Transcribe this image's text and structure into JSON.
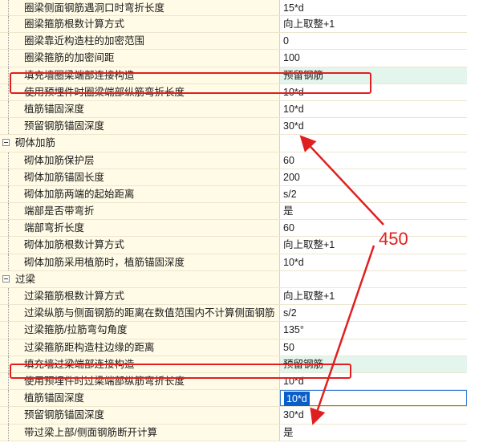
{
  "rows": [
    {
      "label": "圈梁侧面钢筋遇洞口时弯折长度",
      "value": "15*d"
    },
    {
      "label": "圈梁箍筋根数计算方式",
      "value": "向上取整+1"
    },
    {
      "label": "圈梁靠近构造柱的加密范围",
      "value": "0"
    },
    {
      "label": "圈梁箍筋的加密间距",
      "value": "100"
    },
    {
      "label": "填充墙圈梁端部连接构造",
      "value": "预留钢筋",
      "highlight": true
    },
    {
      "label": "使用预埋件时圈梁端部纵筋弯折长度",
      "value": "10*d"
    },
    {
      "label": "植筋锚固深度",
      "value": "10*d"
    },
    {
      "label": "预留钢筋锚固深度",
      "value": "30*d"
    },
    {
      "label": "砌体加筋",
      "value": "",
      "group": true
    },
    {
      "label": "砌体加筋保护层",
      "value": "60"
    },
    {
      "label": "砌体加筋锚固长度",
      "value": "200"
    },
    {
      "label": "砌体加筋两端的起始距离",
      "value": "s/2"
    },
    {
      "label": "端部是否带弯折",
      "value": "是"
    },
    {
      "label": "端部弯折长度",
      "value": "60"
    },
    {
      "label": "砌体加筋根数计算方式",
      "value": "向上取整+1"
    },
    {
      "label": "砌体加筋采用植筋时，植筋锚固深度",
      "value": "10*d"
    },
    {
      "label": "过梁",
      "value": "",
      "group": true
    },
    {
      "label": "过梁箍筋根数计算方式",
      "value": "向上取整+1"
    },
    {
      "label": "过梁纵筋与侧面钢筋的距离在数值范围内不计算侧面钢筋",
      "value": "s/2"
    },
    {
      "label": "过梁箍筋/拉筋弯勾角度",
      "value": "135°"
    },
    {
      "label": "过梁箍筋距构造柱边缘的距离",
      "value": "50"
    },
    {
      "label": "填充墙过梁端部连接构造",
      "value": "预留钢筋",
      "highlight": true
    },
    {
      "label": "使用预埋件时过梁端部纵筋弯折长度",
      "value": "10*d"
    },
    {
      "label": "植筋锚固深度",
      "value": "10*d",
      "editing": true
    },
    {
      "label": "预留钢筋锚固深度",
      "value": "30*d"
    },
    {
      "label": "带过梁上部/侧面钢筋断开计算",
      "value": "是"
    }
  ],
  "annotation": {
    "text": "450",
    "color": "#e02020"
  },
  "colors": {
    "label_bg": "#fffbe6",
    "highlight_bg": "#e3f5ec",
    "selection": "#0a5ec9",
    "annotation": "#e02020"
  }
}
